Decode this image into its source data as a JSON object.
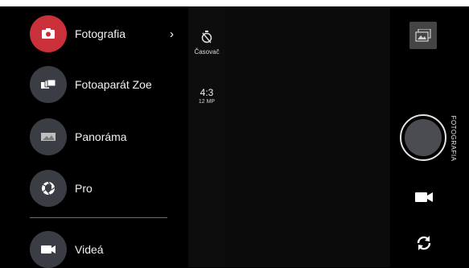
{
  "modes": [
    {
      "label": "Fotografia",
      "icon": "camera-icon",
      "active": true
    },
    {
      "label": "Fotoaparát Zoe",
      "icon": "zoe-camera-icon",
      "active": false
    },
    {
      "label": "Panoráma",
      "icon": "panorama-icon",
      "active": false
    },
    {
      "label": "Pro",
      "icon": "aperture-icon",
      "active": false
    },
    {
      "label": "Videá",
      "icon": "video-icon",
      "active": false
    }
  ],
  "settings": {
    "timer_label": "Časovač",
    "ratio": "4:3",
    "resolution": "12 MP"
  },
  "camera_panel": {
    "current_mode": "FOTOGRAFIA"
  },
  "colors": {
    "active_mode": "#c9303a",
    "mode_icon_bg": "#3b3d44",
    "background": "#000000"
  }
}
